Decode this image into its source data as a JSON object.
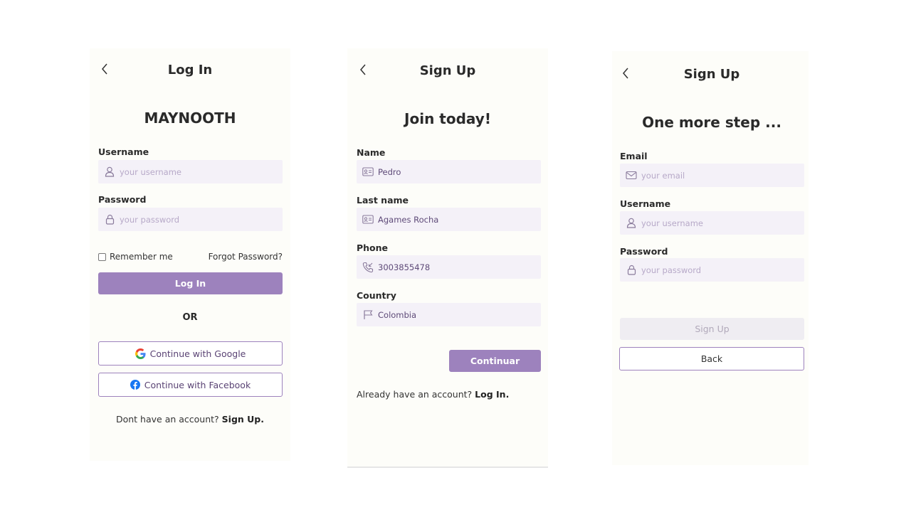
{
  "login": {
    "header_title": "Log In",
    "brand": "MAYNOOTH",
    "username_label": "Username",
    "username_placeholder": "your username",
    "password_label": "Password",
    "password_placeholder": "your password",
    "remember_label": "Remember me",
    "forgot_label": "Forgot Password?",
    "login_button": "Log In",
    "or_text": "OR",
    "google_button": "Continue with Google",
    "facebook_button": "Continue with Facebook",
    "footer_text": "Dont have an account?",
    "footer_link": "Sign Up."
  },
  "signup_step1": {
    "header_title": "Sign Up",
    "heading": "Join today!",
    "name_label": "Name",
    "name_value": "Pedro",
    "lastname_label": "Last name",
    "lastname_value": "Agames Rocha",
    "phone_label": "Phone",
    "phone_value": "3003855478",
    "country_label": "Country",
    "country_value": "Colombia",
    "continue_button": "Continuar",
    "footer_text": "Already have an account?",
    "footer_link": "Log In."
  },
  "signup_step2": {
    "header_title": "Sign Up",
    "heading": "One more step ...",
    "email_label": "Email",
    "email_placeholder": "your email",
    "username_label": "Username",
    "username_placeholder": "your username",
    "password_label": "Password",
    "password_placeholder": "your password",
    "signup_button": "Sign Up",
    "back_button": "Back"
  },
  "icons": {
    "back": "chevron-left-icon",
    "user": "user-icon",
    "lock": "lock-icon",
    "id_card": "id-card-icon",
    "phone": "phone-incoming-icon",
    "flag": "flag-icon",
    "mail": "mail-icon",
    "google": "google-icon",
    "facebook": "facebook-icon"
  },
  "colors": {
    "accent": "#9d82bd",
    "panel_bg": "#fdfdf9",
    "field_bg": "#f4f1f8",
    "facebook": "#1877f2"
  }
}
